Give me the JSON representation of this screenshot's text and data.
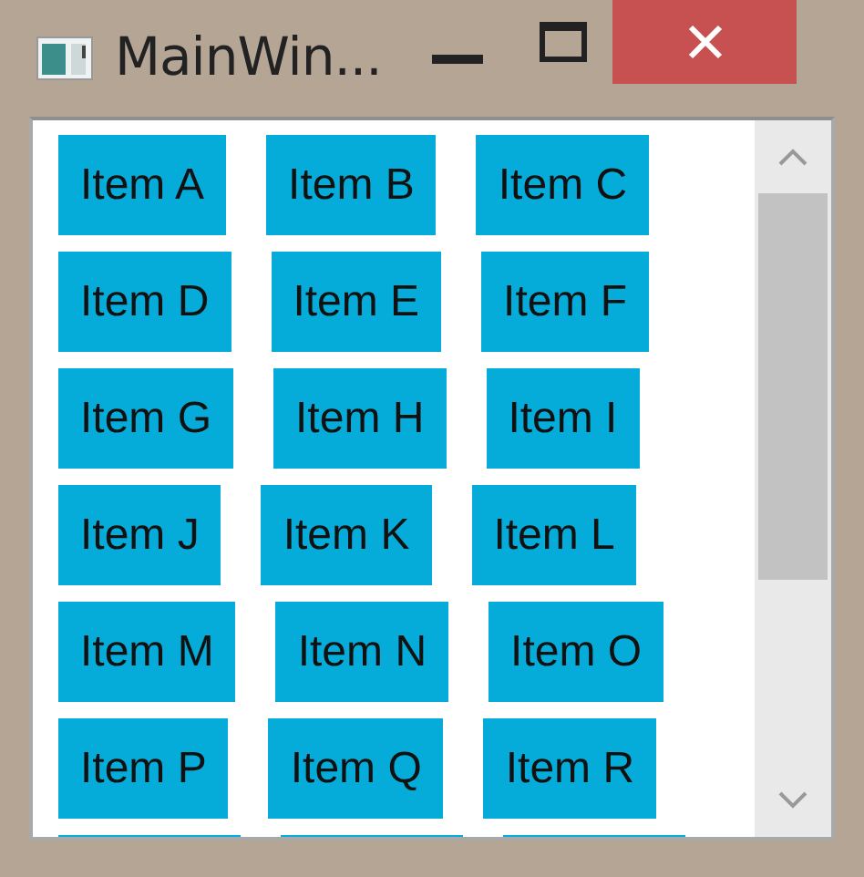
{
  "window": {
    "title": "MainWin..."
  },
  "items": [
    {
      "label": "Item A"
    },
    {
      "label": "Item B"
    },
    {
      "label": "Item C"
    },
    {
      "label": "Item D"
    },
    {
      "label": "Item E"
    },
    {
      "label": "Item F"
    },
    {
      "label": "Item G"
    },
    {
      "label": "Item H"
    },
    {
      "label": "Item I"
    },
    {
      "label": "Item J"
    },
    {
      "label": "Item K"
    },
    {
      "label": "Item L"
    },
    {
      "label": "Item M"
    },
    {
      "label": "Item N"
    },
    {
      "label": "Item O"
    },
    {
      "label": "Item P"
    },
    {
      "label": "Item Q"
    },
    {
      "label": "Item R"
    }
  ],
  "cut_items": [
    {
      "kind": "cut"
    },
    {
      "kind": "cut"
    },
    {
      "kind": "cut"
    }
  ]
}
